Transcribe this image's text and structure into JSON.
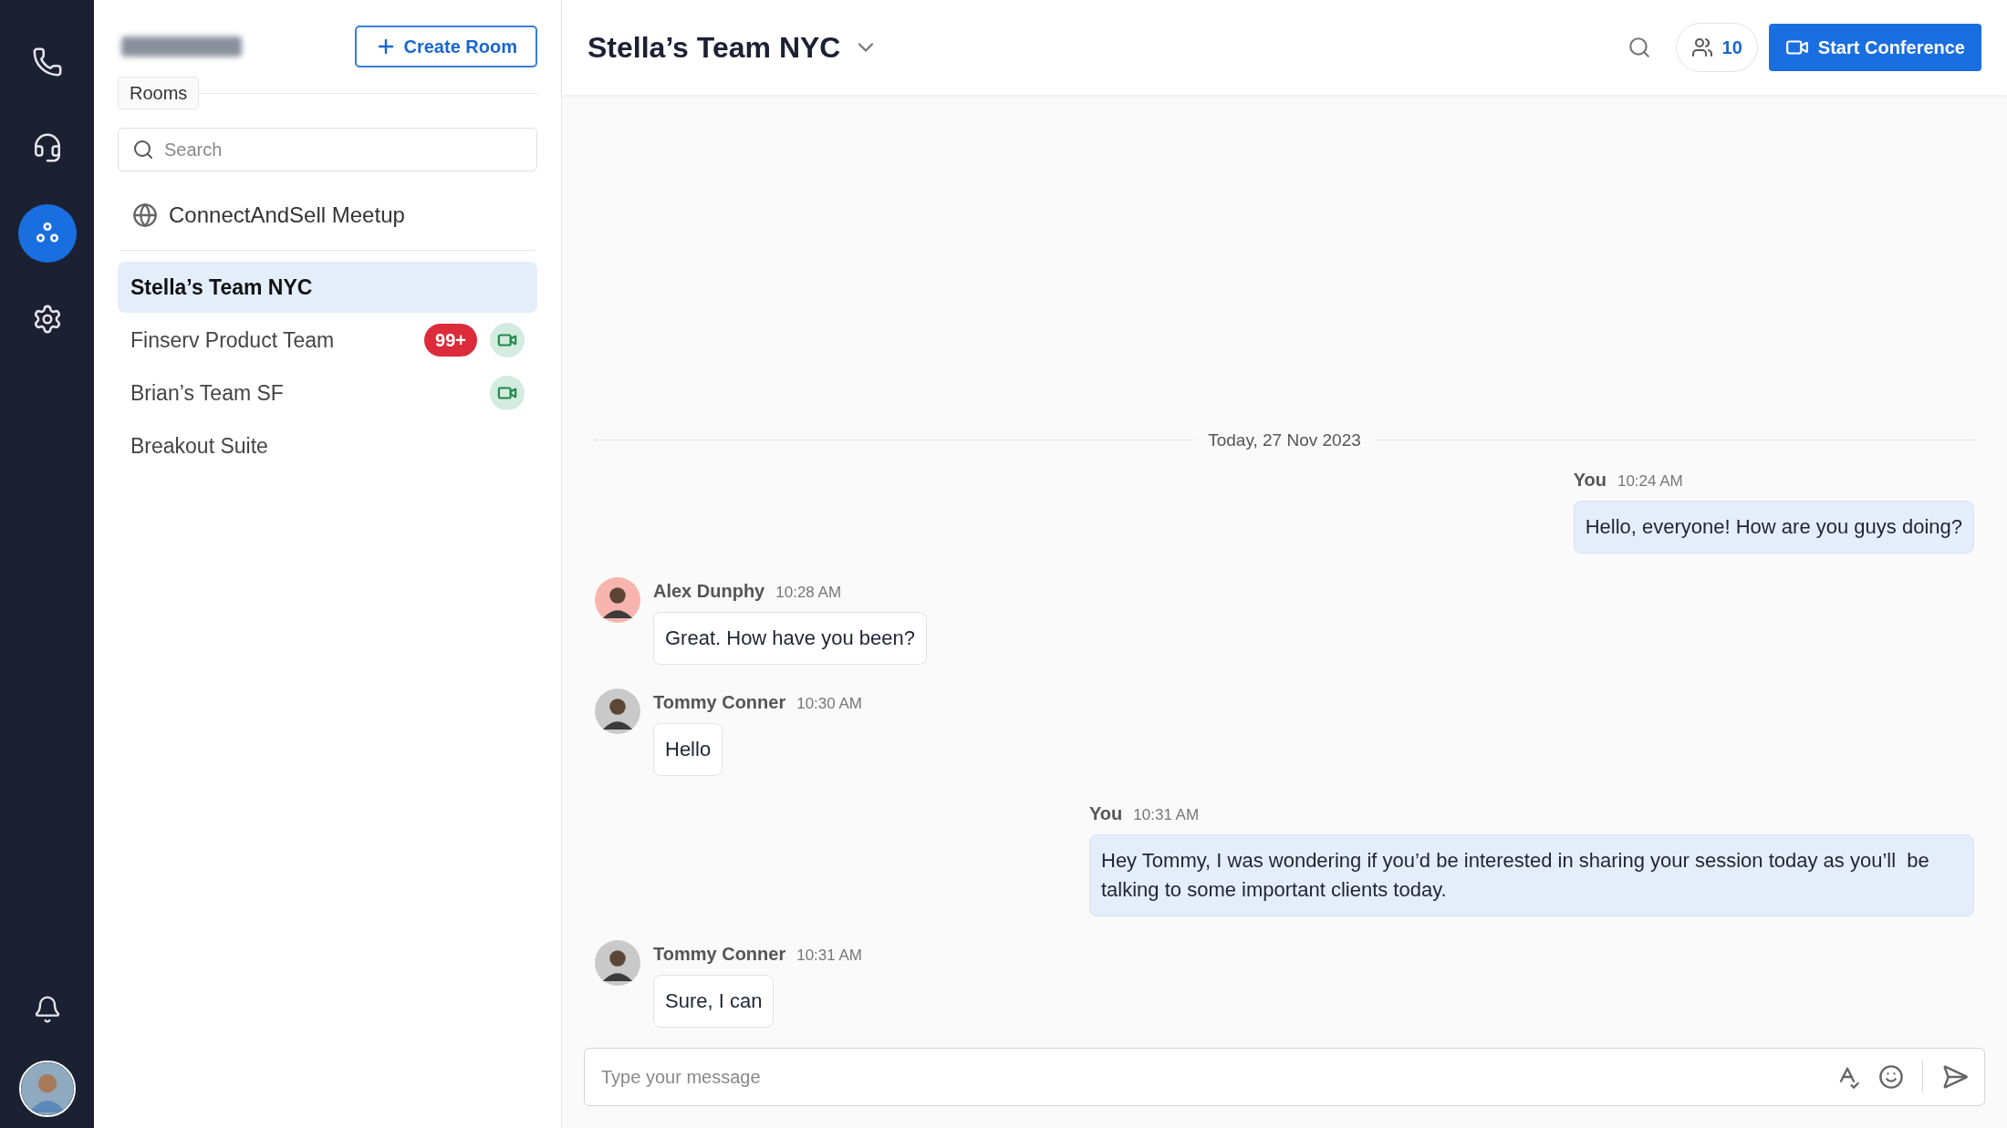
{
  "rail": {
    "items": [
      {
        "kind": "phone",
        "selected": false
      },
      {
        "kind": "headset",
        "selected": false
      },
      {
        "kind": "rooms",
        "selected": true
      },
      {
        "kind": "settings",
        "selected": false
      }
    ],
    "bottom": [
      {
        "kind": "bell"
      },
      {
        "kind": "avatar"
      }
    ]
  },
  "sidebar": {
    "create_button": "Create Room",
    "section_label": "Rooms",
    "search": {
      "placeholder": "Search"
    },
    "pinned": {
      "label": "ConnectAndSell Meetup"
    },
    "rooms": [
      {
        "name": "Stella’s Team NYC",
        "selected": true,
        "video": false
      },
      {
        "name": "Finserv Product Team",
        "selected": false,
        "unread": "99+",
        "video": true
      },
      {
        "name": "Brian’s Team SF",
        "selected": false,
        "video": true
      },
      {
        "name": "Breakout Suite",
        "selected": false,
        "video": false
      }
    ]
  },
  "header": {
    "title": "Stella’s Team NYC",
    "participants": "10",
    "start_button": "Start Conference"
  },
  "chat": {
    "date_divider": "Today, 27 Nov 2023",
    "messages": [
      {
        "sender": "You",
        "time": "10:24 AM",
        "text": "Hello, everyone! How are you guys doing?",
        "mine": true
      },
      {
        "sender": "Alex Dunphy",
        "time": "10:28 AM",
        "text": "Great. How have you been?",
        "mine": false,
        "color": "#f8b4ae"
      },
      {
        "sender": "Tommy Conner",
        "time": "10:30 AM",
        "text": "Hello",
        "mine": false,
        "color": "#c9c9c9"
      },
      {
        "sender": "You",
        "time": "10:31 AM",
        "text": "Hey Tommy, I was wondering if you’d be interested in sharing your session today as you’ll  be talking to some important clients today.",
        "mine": true
      },
      {
        "sender": "Tommy Conner",
        "time": "10:31 AM",
        "text": "Sure, I can",
        "mine": false,
        "color": "#c9c9c9"
      }
    ]
  },
  "composer": {
    "placeholder": "Type your message"
  }
}
